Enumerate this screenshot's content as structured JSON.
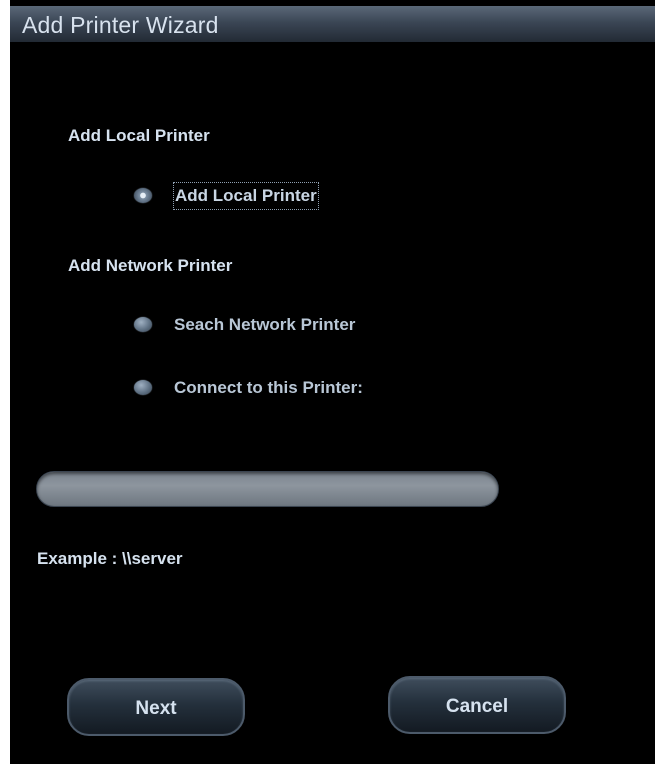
{
  "window": {
    "title": "Add Printer Wizard"
  },
  "local": {
    "section_label": "Add Local Printer",
    "option_label": "Add Local Printer",
    "checked": true
  },
  "network": {
    "section_label": "Add Network Printer",
    "search_label": "Seach Network Printer",
    "connect_label": "Connect to this Printer:",
    "search_checked": false,
    "connect_checked": false
  },
  "printer_path": {
    "value": "",
    "placeholder": ""
  },
  "example": "Example : \\\\server",
  "buttons": {
    "next": "Next",
    "cancel": "Cancel"
  },
  "colors": {
    "background": "#000000",
    "title_bar": "#3b4655",
    "text": "#d6e2ef",
    "input_fill": "#8d959e"
  },
  "icons": {
    "radio": "radio-button-icon"
  }
}
